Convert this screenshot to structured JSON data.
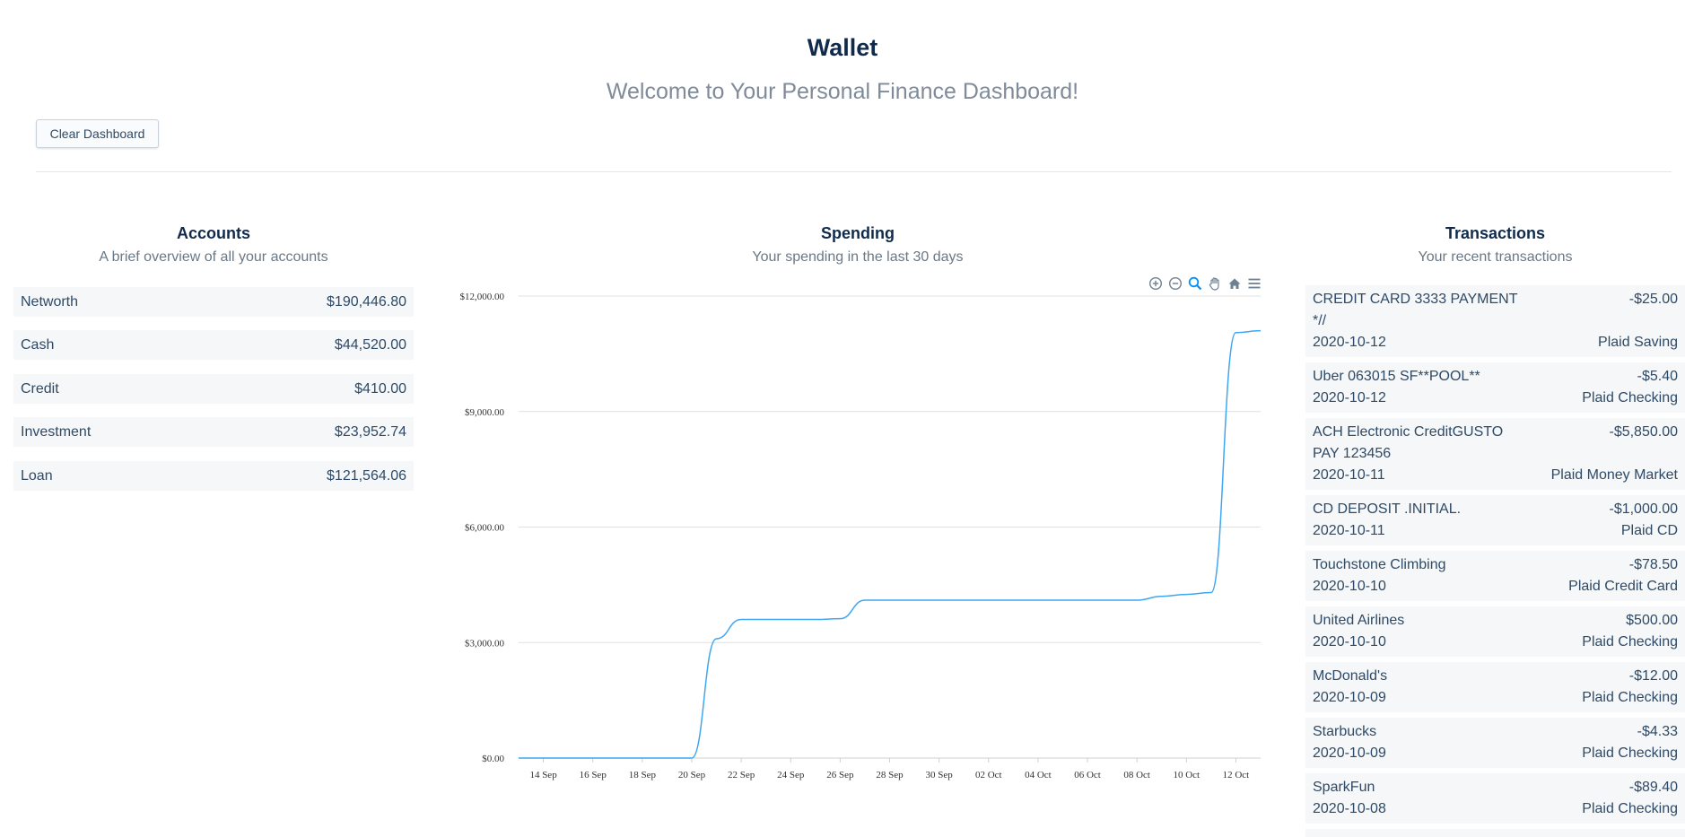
{
  "header": {
    "title": "Wallet",
    "subtitle": "Welcome to Your Personal Finance Dashboard!",
    "clear_button": "Clear Dashboard"
  },
  "accounts": {
    "title": "Accounts",
    "subtitle": "A brief overview of all your accounts",
    "items": [
      {
        "name": "Networth",
        "value": "$190,446.80"
      },
      {
        "name": "Cash",
        "value": "$44,520.00"
      },
      {
        "name": "Credit",
        "value": "$410.00"
      },
      {
        "name": "Investment",
        "value": "$23,952.74"
      },
      {
        "name": "Loan",
        "value": "$121,564.06"
      }
    ]
  },
  "spending": {
    "title": "Spending",
    "subtitle": "Your spending in the last 30 days",
    "toolbar": [
      "zoom-in-icon",
      "zoom-out-icon",
      "selection-zoom-icon",
      "pan-hand-icon",
      "reset-home-icon",
      "menu-icon"
    ]
  },
  "transactions": {
    "title": "Transactions",
    "subtitle": "Your recent transactions",
    "items": [
      {
        "name": "CREDIT CARD 3333 PAYMENT *//",
        "amount": "-$25.00",
        "date": "2020-10-12",
        "account": "Plaid Saving"
      },
      {
        "name": "Uber 063015 SF**POOL**",
        "amount": "-$5.40",
        "date": "2020-10-12",
        "account": "Plaid Checking"
      },
      {
        "name": "ACH Electronic CreditGUSTO PAY 123456",
        "amount": "-$5,850.00",
        "date": "2020-10-11",
        "account": "Plaid Money Market"
      },
      {
        "name": "CD DEPOSIT .INITIAL.",
        "amount": "-$1,000.00",
        "date": "2020-10-11",
        "account": "Plaid CD"
      },
      {
        "name": "Touchstone Climbing",
        "amount": "-$78.50",
        "date": "2020-10-10",
        "account": "Plaid Credit Card"
      },
      {
        "name": "United Airlines",
        "amount": "$500.00",
        "date": "2020-10-10",
        "account": "Plaid Checking"
      },
      {
        "name": "McDonald's",
        "amount": "-$12.00",
        "date": "2020-10-09",
        "account": "Plaid Checking"
      },
      {
        "name": "Starbucks",
        "amount": "-$4.33",
        "date": "2020-10-09",
        "account": "Plaid Checking"
      },
      {
        "name": "SparkFun",
        "amount": "-$89.40",
        "date": "2020-10-08",
        "account": "Plaid Checking"
      }
    ]
  },
  "chart_data": {
    "type": "line",
    "line_color": "#3ea6f2",
    "ylim": [
      0,
      12000
    ],
    "yticks": [
      0,
      3000,
      6000,
      9000,
      12000
    ],
    "ytick_labels": [
      "$0.00",
      "$3,000.00",
      "$6,000.00",
      "$9,000.00",
      "$12,000.00"
    ],
    "xtick_labels": [
      "14 Sep",
      "16 Sep",
      "18 Sep",
      "20 Sep",
      "22 Sep",
      "24 Sep",
      "26 Sep",
      "28 Sep",
      "30 Sep",
      "02 Oct",
      "04 Oct",
      "06 Oct",
      "08 Oct",
      "10 Oct",
      "12 Oct"
    ],
    "x": [
      "13 Sep",
      "14 Sep",
      "15 Sep",
      "16 Sep",
      "17 Sep",
      "18 Sep",
      "19 Sep",
      "20 Sep",
      "21 Sep",
      "22 Sep",
      "23 Sep",
      "24 Sep",
      "25 Sep",
      "26 Sep",
      "27 Sep",
      "28 Sep",
      "29 Sep",
      "30 Sep",
      "01 Oct",
      "02 Oct",
      "03 Oct",
      "04 Oct",
      "05 Oct",
      "06 Oct",
      "07 Oct",
      "08 Oct",
      "09 Oct",
      "10 Oct",
      "11 Oct",
      "12 Oct",
      "13 Oct"
    ],
    "values": [
      0,
      0,
      0,
      0,
      0,
      0,
      0,
      0,
      3100,
      3600,
      3600,
      3600,
      3600,
      3620,
      4100,
      4100,
      4100,
      4100,
      4100,
      4100,
      4100,
      4100,
      4100,
      4100,
      4100,
      4100,
      4200,
      4250,
      4300,
      11050,
      11100
    ],
    "grid": true,
    "legend": "none"
  }
}
